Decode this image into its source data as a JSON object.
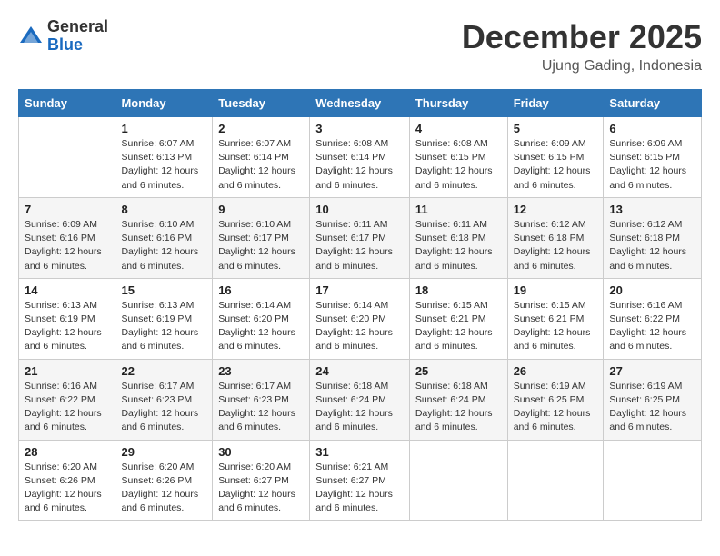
{
  "logo": {
    "general": "General",
    "blue": "Blue"
  },
  "header": {
    "month": "December 2025",
    "location": "Ujung Gading, Indonesia"
  },
  "weekdays": [
    "Sunday",
    "Monday",
    "Tuesday",
    "Wednesday",
    "Thursday",
    "Friday",
    "Saturday"
  ],
  "weeks": [
    [
      {
        "day": "",
        "sunrise": "",
        "sunset": "",
        "daylight": ""
      },
      {
        "day": "1",
        "sunrise": "Sunrise: 6:07 AM",
        "sunset": "Sunset: 6:13 PM",
        "daylight": "Daylight: 12 hours and 6 minutes."
      },
      {
        "day": "2",
        "sunrise": "Sunrise: 6:07 AM",
        "sunset": "Sunset: 6:14 PM",
        "daylight": "Daylight: 12 hours and 6 minutes."
      },
      {
        "day": "3",
        "sunrise": "Sunrise: 6:08 AM",
        "sunset": "Sunset: 6:14 PM",
        "daylight": "Daylight: 12 hours and 6 minutes."
      },
      {
        "day": "4",
        "sunrise": "Sunrise: 6:08 AM",
        "sunset": "Sunset: 6:15 PM",
        "daylight": "Daylight: 12 hours and 6 minutes."
      },
      {
        "day": "5",
        "sunrise": "Sunrise: 6:09 AM",
        "sunset": "Sunset: 6:15 PM",
        "daylight": "Daylight: 12 hours and 6 minutes."
      },
      {
        "day": "6",
        "sunrise": "Sunrise: 6:09 AM",
        "sunset": "Sunset: 6:15 PM",
        "daylight": "Daylight: 12 hours and 6 minutes."
      }
    ],
    [
      {
        "day": "7",
        "sunrise": "Sunrise: 6:09 AM",
        "sunset": "Sunset: 6:16 PM",
        "daylight": "Daylight: 12 hours and 6 minutes."
      },
      {
        "day": "8",
        "sunrise": "Sunrise: 6:10 AM",
        "sunset": "Sunset: 6:16 PM",
        "daylight": "Daylight: 12 hours and 6 minutes."
      },
      {
        "day": "9",
        "sunrise": "Sunrise: 6:10 AM",
        "sunset": "Sunset: 6:17 PM",
        "daylight": "Daylight: 12 hours and 6 minutes."
      },
      {
        "day": "10",
        "sunrise": "Sunrise: 6:11 AM",
        "sunset": "Sunset: 6:17 PM",
        "daylight": "Daylight: 12 hours and 6 minutes."
      },
      {
        "day": "11",
        "sunrise": "Sunrise: 6:11 AM",
        "sunset": "Sunset: 6:18 PM",
        "daylight": "Daylight: 12 hours and 6 minutes."
      },
      {
        "day": "12",
        "sunrise": "Sunrise: 6:12 AM",
        "sunset": "Sunset: 6:18 PM",
        "daylight": "Daylight: 12 hours and 6 minutes."
      },
      {
        "day": "13",
        "sunrise": "Sunrise: 6:12 AM",
        "sunset": "Sunset: 6:18 PM",
        "daylight": "Daylight: 12 hours and 6 minutes."
      }
    ],
    [
      {
        "day": "14",
        "sunrise": "Sunrise: 6:13 AM",
        "sunset": "Sunset: 6:19 PM",
        "daylight": "Daylight: 12 hours and 6 minutes."
      },
      {
        "day": "15",
        "sunrise": "Sunrise: 6:13 AM",
        "sunset": "Sunset: 6:19 PM",
        "daylight": "Daylight: 12 hours and 6 minutes."
      },
      {
        "day": "16",
        "sunrise": "Sunrise: 6:14 AM",
        "sunset": "Sunset: 6:20 PM",
        "daylight": "Daylight: 12 hours and 6 minutes."
      },
      {
        "day": "17",
        "sunrise": "Sunrise: 6:14 AM",
        "sunset": "Sunset: 6:20 PM",
        "daylight": "Daylight: 12 hours and 6 minutes."
      },
      {
        "day": "18",
        "sunrise": "Sunrise: 6:15 AM",
        "sunset": "Sunset: 6:21 PM",
        "daylight": "Daylight: 12 hours and 6 minutes."
      },
      {
        "day": "19",
        "sunrise": "Sunrise: 6:15 AM",
        "sunset": "Sunset: 6:21 PM",
        "daylight": "Daylight: 12 hours and 6 minutes."
      },
      {
        "day": "20",
        "sunrise": "Sunrise: 6:16 AM",
        "sunset": "Sunset: 6:22 PM",
        "daylight": "Daylight: 12 hours and 6 minutes."
      }
    ],
    [
      {
        "day": "21",
        "sunrise": "Sunrise: 6:16 AM",
        "sunset": "Sunset: 6:22 PM",
        "daylight": "Daylight: 12 hours and 6 minutes."
      },
      {
        "day": "22",
        "sunrise": "Sunrise: 6:17 AM",
        "sunset": "Sunset: 6:23 PM",
        "daylight": "Daylight: 12 hours and 6 minutes."
      },
      {
        "day": "23",
        "sunrise": "Sunrise: 6:17 AM",
        "sunset": "Sunset: 6:23 PM",
        "daylight": "Daylight: 12 hours and 6 minutes."
      },
      {
        "day": "24",
        "sunrise": "Sunrise: 6:18 AM",
        "sunset": "Sunset: 6:24 PM",
        "daylight": "Daylight: 12 hours and 6 minutes."
      },
      {
        "day": "25",
        "sunrise": "Sunrise: 6:18 AM",
        "sunset": "Sunset: 6:24 PM",
        "daylight": "Daylight: 12 hours and 6 minutes."
      },
      {
        "day": "26",
        "sunrise": "Sunrise: 6:19 AM",
        "sunset": "Sunset: 6:25 PM",
        "daylight": "Daylight: 12 hours and 6 minutes."
      },
      {
        "day": "27",
        "sunrise": "Sunrise: 6:19 AM",
        "sunset": "Sunset: 6:25 PM",
        "daylight": "Daylight: 12 hours and 6 minutes."
      }
    ],
    [
      {
        "day": "28",
        "sunrise": "Sunrise: 6:20 AM",
        "sunset": "Sunset: 6:26 PM",
        "daylight": "Daylight: 12 hours and 6 minutes."
      },
      {
        "day": "29",
        "sunrise": "Sunrise: 6:20 AM",
        "sunset": "Sunset: 6:26 PM",
        "daylight": "Daylight: 12 hours and 6 minutes."
      },
      {
        "day": "30",
        "sunrise": "Sunrise: 6:20 AM",
        "sunset": "Sunset: 6:27 PM",
        "daylight": "Daylight: 12 hours and 6 minutes."
      },
      {
        "day": "31",
        "sunrise": "Sunrise: 6:21 AM",
        "sunset": "Sunset: 6:27 PM",
        "daylight": "Daylight: 12 hours and 6 minutes."
      },
      {
        "day": "",
        "sunrise": "",
        "sunset": "",
        "daylight": ""
      },
      {
        "day": "",
        "sunrise": "",
        "sunset": "",
        "daylight": ""
      },
      {
        "day": "",
        "sunrise": "",
        "sunset": "",
        "daylight": ""
      }
    ]
  ]
}
